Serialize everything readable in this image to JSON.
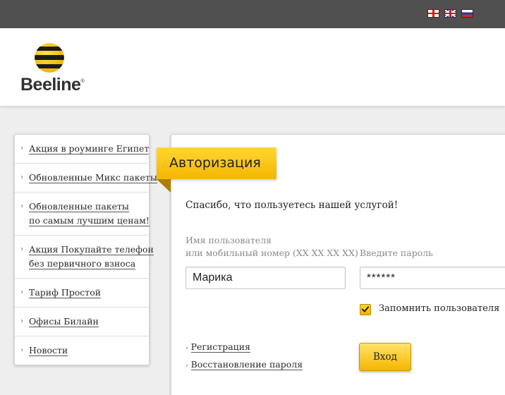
{
  "languages": [
    {
      "name": "georgian-flag-icon"
    },
    {
      "name": "english-flag-icon"
    },
    {
      "name": "russian-flag-icon"
    }
  ],
  "brand": {
    "name": "Beeline",
    "logo_icon": "beeline-striped-ball-icon",
    "colors": {
      "yellow": "#f5b600",
      "black": "#222222"
    }
  },
  "sidebar": {
    "items": [
      {
        "lines": [
          "Акция в роуминге Египет"
        ]
      },
      {
        "lines": [
          "Обновленные Микс пакеты"
        ]
      },
      {
        "lines": [
          "Обновленные пакеты",
          "по самым лучшим ценам!"
        ]
      },
      {
        "lines": [
          "Акция Покупайте телефон",
          "без первичного взноса"
        ]
      },
      {
        "lines": [
          "Тариф Простой"
        ]
      },
      {
        "lines": [
          "Офисы Билайн"
        ]
      },
      {
        "lines": [
          "Новости"
        ]
      }
    ]
  },
  "auth": {
    "title": "Авторизация",
    "thanks": "Спасибо, что пользуетесь нашей услугой!",
    "username_label_line1": "Имя пользователя",
    "username_label_line2": "или мобильный номер (XX XX XX XX)",
    "username_value": "Марика",
    "password_label": "Введите пароль",
    "password_value": "******",
    "remember_label": "Запомнить пользователя",
    "remember_checked": true,
    "register_link": "Регистрация",
    "recover_link": "Восстановление пароля",
    "login_button": "Вход"
  }
}
